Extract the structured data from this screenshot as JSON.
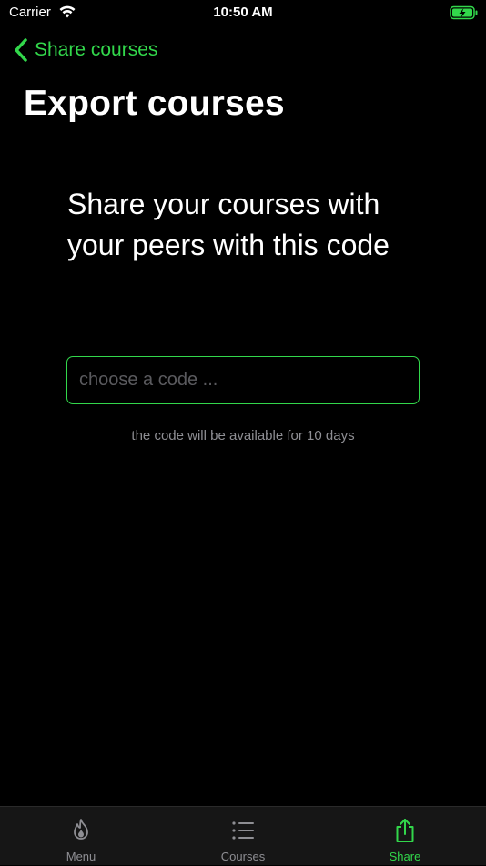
{
  "status_bar": {
    "carrier": "Carrier",
    "time": "10:50 AM"
  },
  "nav": {
    "back_label": "Share courses",
    "title": "Export courses"
  },
  "main": {
    "headline_line1": "Share your courses with",
    "headline_line2": "your peers with this code",
    "code_input": {
      "value": "",
      "placeholder": "choose a code ..."
    },
    "hint": "the code will be available for 10 days"
  },
  "tab_bar": {
    "tabs": [
      {
        "label": "Menu",
        "icon": "flame-icon",
        "active": false
      },
      {
        "label": "Courses",
        "icon": "list-icon",
        "active": false
      },
      {
        "label": "Share",
        "icon": "share-icon",
        "active": true
      }
    ]
  },
  "colors": {
    "accent": "#32d74b",
    "background": "#000000",
    "tab_inactive": "#8e8e93",
    "tab_bar_bg": "#161616"
  }
}
